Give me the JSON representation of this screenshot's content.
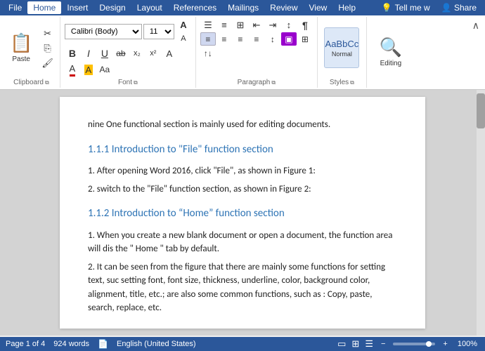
{
  "menubar": {
    "items": [
      "File",
      "Home",
      "Insert",
      "Design",
      "Layout",
      "References",
      "Mailings",
      "Review",
      "View",
      "Help"
    ],
    "active": "Home",
    "tell_me": "Tell me w",
    "share": "Share"
  },
  "ribbon": {
    "clipboard": {
      "label": "Clipboard",
      "paste": "Paste",
      "cut": "✂",
      "copy": "⎘",
      "format": "🖌"
    },
    "font": {
      "label": "Font",
      "family": "Calibri (Body)",
      "size": "11",
      "bold": "B",
      "italic": "I",
      "underline": "U",
      "strikethrough": "ab",
      "sub": "x₂",
      "sup": "x²",
      "grow": "A",
      "shrink": "A",
      "case": "Aa",
      "clear": "A",
      "highlight": "A",
      "color": "A"
    },
    "paragraph": {
      "label": "Paragraph"
    },
    "styles": {
      "label": "Styles",
      "preview": "AaBbCc"
    },
    "editing": {
      "label": "Editing",
      "icon": "🔍"
    }
  },
  "document": {
    "intro_text": "nine One functional section is mainly used for editing documents.",
    "section1": {
      "heading": "1.1.1 Introduction to \"File\" function section",
      "items": [
        "1. After opening Word 2016, click \"File\", as shown in Figure 1:",
        "2. switch to the \"File\" function section, as shown in Figure 2:"
      ]
    },
    "section2": {
      "heading": "1.1.2 Introduction to “Home” function section",
      "items": [
        "1. When you create a new blank document or open a document, the function area will dis the \" Home \" tab by default.",
        "2. It can be seen from the figure that there are mainly some functions for setting text, suc setting font, font size, thickness, underline, color, background color, alignment, title, etc.; are also some common functions, such as : Copy, paste, search, replace, etc."
      ]
    }
  },
  "statusbar": {
    "page": "Page 1 of 4",
    "words": "924 words",
    "language": "English (United States)",
    "zoom": "100%"
  }
}
